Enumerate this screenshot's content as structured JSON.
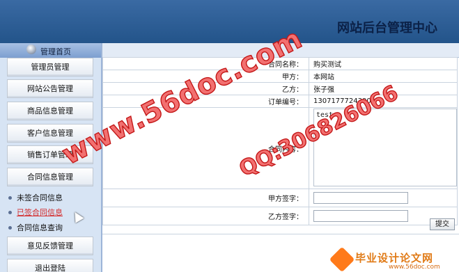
{
  "header": {
    "title": "网站后台管理中心"
  },
  "sidebar": {
    "home_label": "管理首页",
    "items": [
      {
        "label": "管理员管理"
      },
      {
        "label": "网站公告管理"
      },
      {
        "label": "商品信息管理"
      },
      {
        "label": "客户信息管理"
      },
      {
        "label": "销售订单管理"
      },
      {
        "label": "合同信息管理"
      }
    ],
    "subitems": [
      {
        "label": "未签合同信息",
        "active": false
      },
      {
        "label": "已签合同信息",
        "active": true
      },
      {
        "label": "合同信息查询",
        "active": false
      }
    ],
    "items_after": [
      {
        "label": "意见反馈管理"
      },
      {
        "label": "退出登陆"
      }
    ]
  },
  "form": {
    "contract_name_label": "合同名称：",
    "contract_name_value": "购买测试",
    "party_a_label": "甲方：",
    "party_a_value": "本网站",
    "party_b_label": "乙方：",
    "party_b_value": "张子强",
    "order_no_label": "订单编号：",
    "order_no_value": "1307177724390",
    "content_label": "合同内容：",
    "content_value": "test",
    "party_a_sign_label": "甲方签字：",
    "party_a_sign_value": "",
    "party_b_sign_label": "乙方签字：",
    "party_b_sign_value": "",
    "submit_label": "提交"
  },
  "watermarks": {
    "site": "www.56doc.com",
    "qq": "QQ:306826066"
  },
  "footer_logo": {
    "title": "毕业设计论文网",
    "url": "www.56doc.com"
  },
  "colors": {
    "header_bg": "#2b5c94",
    "sidebar_bg": "#d7e4f4",
    "active_link": "#d42a2a",
    "watermark": "#e23b3b",
    "logo_orange": "#e07a16"
  }
}
